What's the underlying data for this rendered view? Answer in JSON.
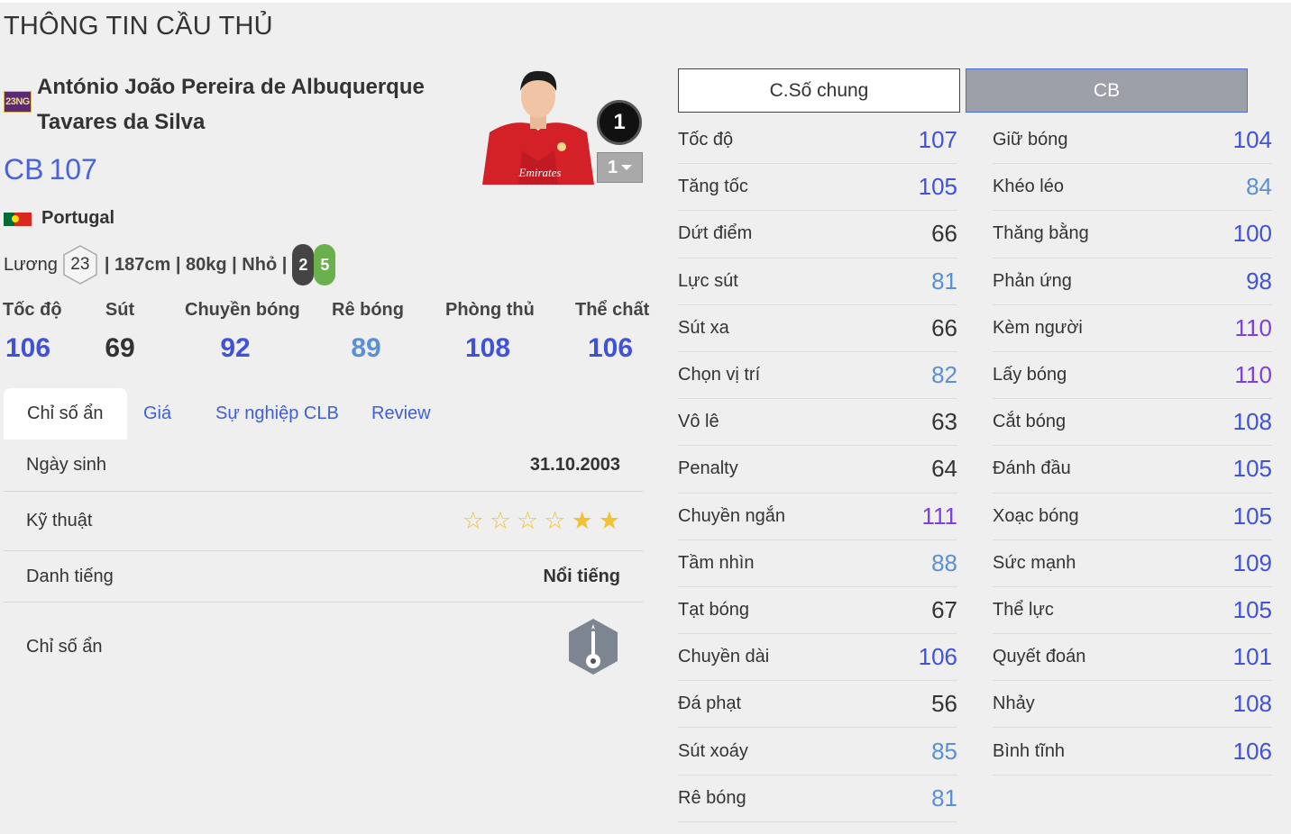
{
  "page_title": "THÔNG TIN CẦU THỦ",
  "player": {
    "season_badge": "23NG",
    "name": "António João Pereira de Albuquerque Tavares da Silva",
    "position": "CB",
    "ovr": "107",
    "nation": "Portugal",
    "salary_label": "Lương",
    "salary": "23",
    "info": "| 187cm | 80kg | Nhỏ |",
    "weak_foot_left": "2",
    "weak_foot_right": "5",
    "rank": "1",
    "level": "1"
  },
  "main_stats": [
    {
      "label": "Tốc độ",
      "value": "106",
      "color": "#3f52d8"
    },
    {
      "label": "Sút",
      "value": "69",
      "color": "#333333"
    },
    {
      "label": "Chuyền bóng",
      "value": "92",
      "color": "#3f52d8"
    },
    {
      "label": "Rê bóng",
      "value": "89",
      "color": "#5a8fd6"
    },
    {
      "label": "Phòng thủ",
      "value": "108",
      "color": "#3f52d8"
    },
    {
      "label": "Thể chất",
      "value": "106",
      "color": "#3f52d8"
    }
  ],
  "tabs": [
    "Chỉ số ẩn",
    "Giá",
    "Sự nghiệp CLB",
    "Review"
  ],
  "details": {
    "birthday_label": "Ngày sinh",
    "birthday": "31.10.2003",
    "skill_label": "Kỹ thuật",
    "skill_stars": 2,
    "skill_max": 6,
    "fame_label": "Danh tiếng",
    "fame": "Nổi tiếng",
    "hidden_label": "Chỉ số ẩn"
  },
  "buttons": {
    "general": "C.Số chung",
    "position": "CB"
  },
  "colors": {
    "blue_high": "#3f52d8",
    "blue_mid": "#5a8fd6",
    "purple": "#7c3fe0",
    "neutral": "#333333"
  },
  "attributes_left": [
    {
      "name": "Tốc độ",
      "value": "107",
      "tone": "blue_high"
    },
    {
      "name": "Tăng tốc",
      "value": "105",
      "tone": "blue_high"
    },
    {
      "name": "Dứt điểm",
      "value": "66",
      "tone": "neutral"
    },
    {
      "name": "Lực sút",
      "value": "81",
      "tone": "blue_mid"
    },
    {
      "name": "Sút xa",
      "value": "66",
      "tone": "neutral"
    },
    {
      "name": "Chọn vị trí",
      "value": "82",
      "tone": "blue_mid"
    },
    {
      "name": "Vô lê",
      "value": "63",
      "tone": "neutral"
    },
    {
      "name": "Penalty",
      "value": "64",
      "tone": "neutral"
    },
    {
      "name": "Chuyền ngắn",
      "value": "111",
      "tone": "purple"
    },
    {
      "name": "Tầm nhìn",
      "value": "88",
      "tone": "blue_mid"
    },
    {
      "name": "Tạt bóng",
      "value": "67",
      "tone": "neutral"
    },
    {
      "name": "Chuyền dài",
      "value": "106",
      "tone": "blue_high"
    },
    {
      "name": "Đá phạt",
      "value": "56",
      "tone": "neutral"
    },
    {
      "name": "Sút xoáy",
      "value": "85",
      "tone": "blue_mid"
    },
    {
      "name": "Rê bóng",
      "value": "81",
      "tone": "blue_mid"
    }
  ],
  "attributes_right": [
    {
      "name": "Giữ bóng",
      "value": "104",
      "tone": "blue_high"
    },
    {
      "name": "Khéo léo",
      "value": "84",
      "tone": "blue_mid"
    },
    {
      "name": "Thăng bằng",
      "value": "100",
      "tone": "blue_high"
    },
    {
      "name": "Phản ứng",
      "value": "98",
      "tone": "blue_high"
    },
    {
      "name": "Kèm người",
      "value": "110",
      "tone": "purple"
    },
    {
      "name": "Lấy bóng",
      "value": "110",
      "tone": "purple"
    },
    {
      "name": "Cắt bóng",
      "value": "108",
      "tone": "blue_high"
    },
    {
      "name": "Đánh đầu",
      "value": "105",
      "tone": "blue_high"
    },
    {
      "name": "Xoạc bóng",
      "value": "105",
      "tone": "blue_high"
    },
    {
      "name": "Sức mạnh",
      "value": "109",
      "tone": "blue_high"
    },
    {
      "name": "Thể lực",
      "value": "105",
      "tone": "blue_high"
    },
    {
      "name": "Quyết đoán",
      "value": "101",
      "tone": "blue_high"
    },
    {
      "name": "Nhảy",
      "value": "108",
      "tone": "blue_high"
    },
    {
      "name": "Bình tĩnh",
      "value": "106",
      "tone": "blue_high"
    }
  ]
}
